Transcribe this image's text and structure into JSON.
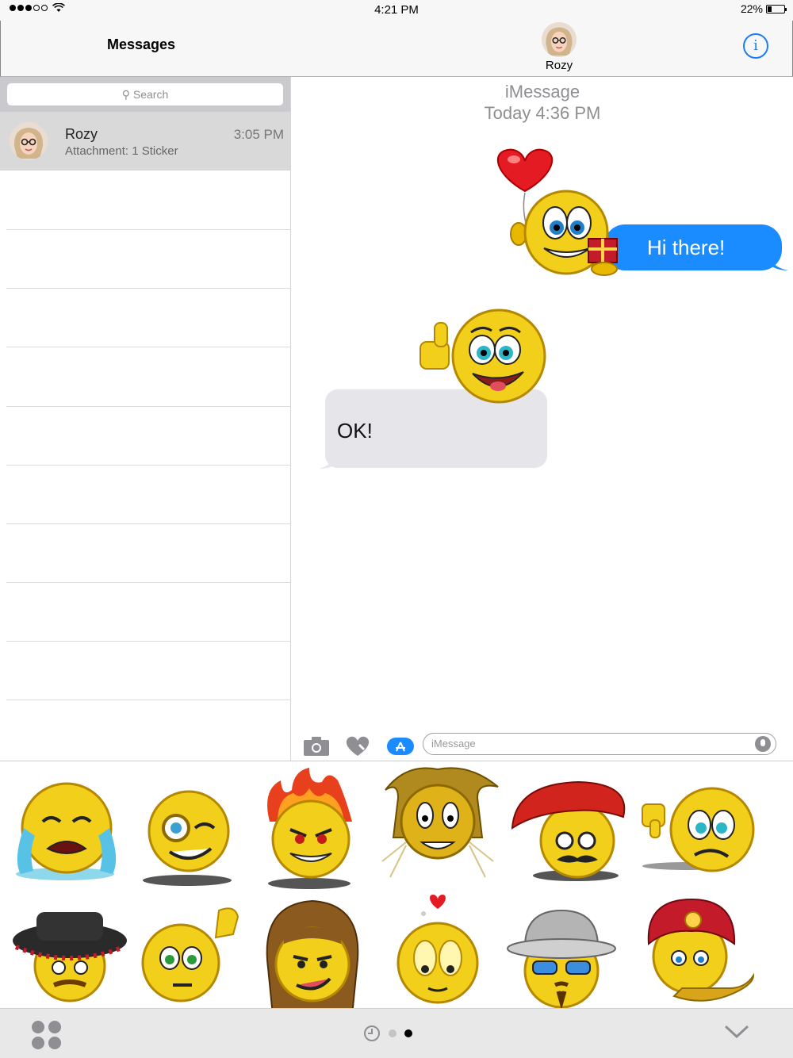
{
  "status_bar": {
    "time": "4:21 PM",
    "battery": "22%",
    "battery_level": 0.22
  },
  "nav": {
    "title": "Messages",
    "contact_name": "Rozy"
  },
  "sidebar": {
    "search_placeholder": "Search",
    "conversations": [
      {
        "name": "Rozy",
        "preview": "Attachment: 1 Sticker",
        "time": "3:05 PM"
      }
    ]
  },
  "chat": {
    "service": "iMessage",
    "timestamp": "Today 4:36 PM",
    "messages": [
      {
        "direction": "outgoing",
        "text": "Hi there!",
        "sticker": "smiley-heart-balloon-gift"
      },
      {
        "direction": "incoming",
        "text": "OK!",
        "sticker": "smiley-thumbs-up"
      }
    ]
  },
  "compose": {
    "placeholder": "iMessage",
    "icons": [
      "camera-icon",
      "digital-touch-icon",
      "app-store-icon",
      "microphone-icon"
    ]
  },
  "sticker_grid": [
    "crying-smiley",
    "monocle-smiley",
    "fire-hair-smiley",
    "lion-mane-smiley",
    "beret-mustache-smiley",
    "thumbs-down-smiley",
    "flamenco-hat-smiley",
    "waving-smiley",
    "long-hair-smiley",
    "love-smiley",
    "pith-helmet-smiley",
    "turban-genie-smiley"
  ],
  "bottom_bar": {
    "page_count": 2,
    "current_page": 2
  },
  "colors": {
    "accent": "#1a8cff",
    "outgoing_bubble": "#1a8cff",
    "incoming_bubble": "#e5e5ea",
    "sidebar_selected": "#d9d9d9",
    "smiley_yellow": "#f2cf1a"
  }
}
